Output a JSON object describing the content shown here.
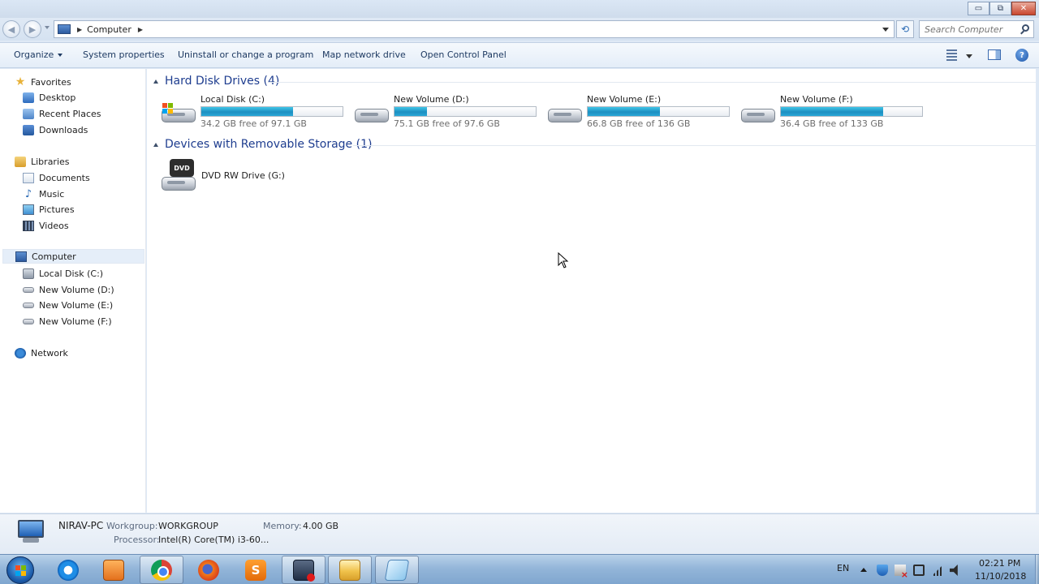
{
  "window": {
    "minimize_glyph": "▭",
    "restore_glyph": "⧉",
    "close_glyph": "✕"
  },
  "address_bar": {
    "crumbs": [
      "Computer"
    ],
    "search_placeholder": "Search Computer"
  },
  "commands": {
    "organize": "Organize",
    "system_properties": "System properties",
    "uninstall": "Uninstall or change a program",
    "map_drive": "Map network drive",
    "control_panel": "Open Control Panel",
    "help_glyph": "?"
  },
  "nav": {
    "favorites": {
      "label": "Favorites",
      "items": [
        "Desktop",
        "Recent Places",
        "Downloads"
      ]
    },
    "libraries": {
      "label": "Libraries",
      "items": [
        "Documents",
        "Music",
        "Pictures",
        "Videos"
      ]
    },
    "computer": {
      "label": "Computer",
      "items": [
        "Local Disk (C:)",
        "New Volume (D:)",
        "New Volume (E:)",
        "New Volume (F:)"
      ]
    },
    "network": {
      "label": "Network"
    }
  },
  "groups": {
    "hard_disks": "Hard Disk Drives (4)",
    "removable": "Devices with Removable Storage (1)"
  },
  "drives": [
    {
      "name": "Local Disk (C:)",
      "free": "34.2 GB free of 97.1 GB",
      "used_fraction": 0.648,
      "icon": "windows-drive-icon"
    },
    {
      "name": "New Volume (D:)",
      "free": "75.1 GB free of 97.6 GB",
      "used_fraction": 0.231,
      "icon": "hard-drive-icon"
    },
    {
      "name": "New Volume (E:)",
      "free": "66.8 GB free of 136 GB",
      "used_fraction": 0.509,
      "icon": "hard-drive-icon"
    },
    {
      "name": "New Volume (F:)",
      "free": "36.4 GB free of 133 GB",
      "used_fraction": 0.726,
      "icon": "hard-drive-icon"
    }
  ],
  "removable": [
    {
      "name": "DVD RW Drive (G:)",
      "badge": "DVD"
    }
  ],
  "details": {
    "pc_name": "NIRAV-PC",
    "workgroup_label": "Workgroup:",
    "workgroup_value": "WORKGROUP",
    "memory_label": "Memory:",
    "memory_value": "4.00 GB",
    "processor_label": "Processor:",
    "processor_value": "Intel(R) Core(TM) i3-60..."
  },
  "taskbar": {
    "apps": [
      "internet-explorer",
      "media-player",
      "chrome",
      "firefox",
      "sublime-text",
      "screen-recorder",
      "windows-explorer",
      "notepad"
    ],
    "language": "EN",
    "time": "02:21 PM",
    "date": "11/10/2018"
  },
  "colors": {
    "accent": "#1e3d8f",
    "bar_fill": "#1d8fc1"
  }
}
